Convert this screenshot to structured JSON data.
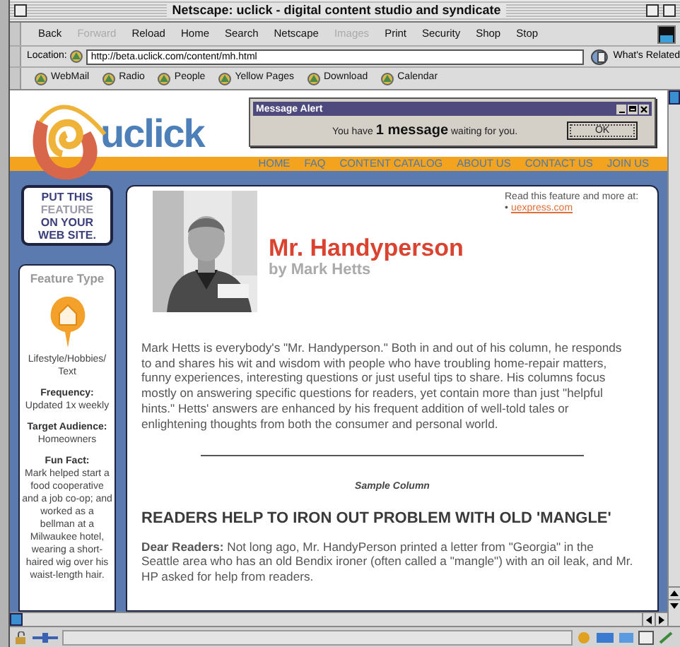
{
  "window": {
    "title": "Netscape: uclick - digital content studio and syndicate"
  },
  "navigation_toolbar": [
    {
      "label": "Back",
      "disabled": false
    },
    {
      "label": "Forward",
      "disabled": true
    },
    {
      "label": "Reload",
      "disabled": false
    },
    {
      "label": "Home",
      "disabled": false
    },
    {
      "label": "Search",
      "disabled": false
    },
    {
      "label": "Netscape",
      "disabled": false
    },
    {
      "label": "Images",
      "disabled": true
    },
    {
      "label": "Print",
      "disabled": false
    },
    {
      "label": "Security",
      "disabled": false
    },
    {
      "label": "Shop",
      "disabled": false
    },
    {
      "label": "Stop",
      "disabled": false
    }
  ],
  "location": {
    "label": "Location:",
    "url": "http://beta.uclick.com/content/mh.html",
    "related": "What's Related"
  },
  "personal_toolbar": [
    "WebMail",
    "Radio",
    "People",
    "Yellow Pages",
    "Download",
    "Calendar"
  ],
  "site": {
    "logo": "uclick",
    "nav": [
      "HOME",
      "FAQ",
      "CONTENT CATALOG",
      "ABOUT US",
      "CONTACT US",
      "JOIN US"
    ],
    "promo": [
      {
        "text": "PUT THIS",
        "color": "#3b3f7a"
      },
      {
        "text": "FEATURE",
        "color": "#9a9aa8"
      },
      {
        "text": "ON YOUR",
        "color": "#3b3f7a"
      },
      {
        "text": "WEB SITE.",
        "color": "#3b3f7a"
      }
    ],
    "sidebar": {
      "heading": "Feature Type",
      "category": "Lifestyle/Hobbies/Text",
      "facts": [
        {
          "label": "Frequency:",
          "value": "Updated 1x weekly"
        },
        {
          "label": "Target Audience:",
          "value": "Homeowners"
        },
        {
          "label": "Fun Fact:",
          "value": "Mark helped start a food cooperative and a job co-op; and worked as a bellman at a Milwaukee hotel, wearing a short-haired wig over his waist-length hair."
        }
      ]
    },
    "article": {
      "title": "Mr. Handyperson",
      "byline": "by Mark Hetts",
      "read_more": "Read this feature and more at:",
      "bullet": "•",
      "link": "uexpress.com",
      "intro": "Mark Hetts is everybody's \"Mr. Handyperson.\" Both in and out of his column, he responds to and shares his wit and wisdom with people who have troubling home-repair matters, funny experiences, interesting questions or just useful tips to share. His columns focus mostly on answering specific questions for readers, yet contain more than just \"helpful hints.\" Hetts' answers are enhanced by his frequent addition of well-told tales or enlightening thoughts from both the consumer and personal world.",
      "sample_label": "Sample Column",
      "headline": "READERS HELP TO IRON OUT PROBLEM WITH OLD 'MANGLE'",
      "paragraphs": [
        "**Dear Readers:** Not long ago, Mr. HandyPerson printed a letter from \"Georgia\" in the Seattle area who has an old Bendix ironer (often called a \"mangle\") with an oil leak, and Mr. HP asked for help from readers."
      ]
    }
  },
  "alert": {
    "title": "Message Alert",
    "message": "You have **1 message** waiting for you.",
    "button": "OK"
  }
}
